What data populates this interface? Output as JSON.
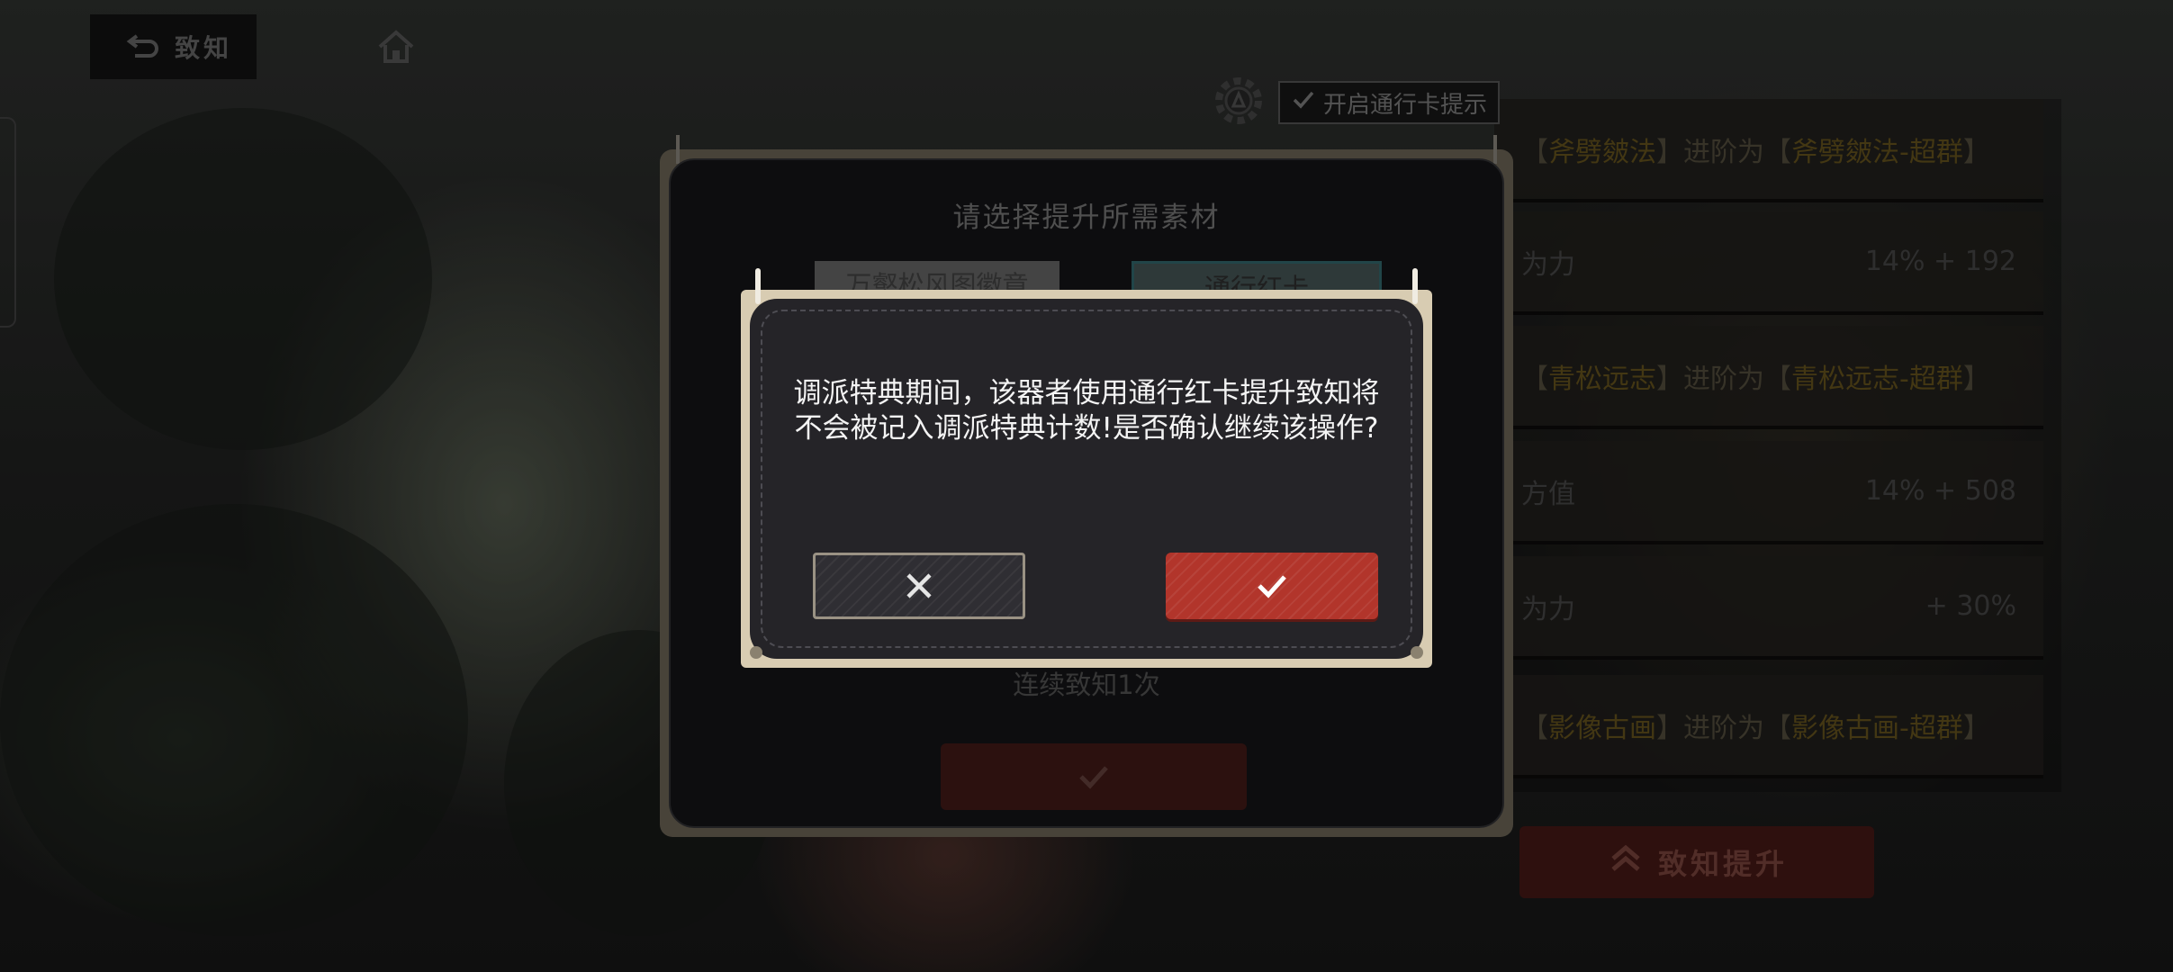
{
  "top_nav": {
    "back_label": "致知"
  },
  "pass_hint": {
    "label": "开启通行卡提示"
  },
  "material_dialog": {
    "title": "请选择提升所需素材",
    "tabs": [
      {
        "label": "万壑松风图徽章"
      },
      {
        "label": "通行红卡"
      }
    ],
    "count_label": "连续致知1次"
  },
  "right_panel": {
    "rows": [
      {
        "prefix": "【",
        "name": "斧劈皴法",
        "mid": "】进阶为【",
        "target": "斧劈皴法-超群",
        "suffix": "】"
      },
      {
        "stat": "为力",
        "value": "14% + 192"
      },
      {
        "prefix": "【",
        "name": "青松远志",
        "mid": "】进阶为【",
        "target": "青松远志-超群",
        "suffix": "】"
      },
      {
        "stat": "方值",
        "value": "14% + 508"
      },
      {
        "stat": "为力",
        "value": "+ 30%"
      },
      {
        "prefix": "【",
        "name": "影像古画",
        "mid": "】进阶为【",
        "target": "影像古画-超群",
        "suffix": "】"
      }
    ],
    "upgrade_button": "致知提升"
  },
  "confirm_modal": {
    "message": "调派特典期间，该器者使用通行红卡提升致知将不会被记入调派特典计数!是否确认继续该操作?"
  },
  "colors": {
    "confirm_red": "#b2352b",
    "modal_frame": "#d8ccb2",
    "modal_bg": "#252428"
  }
}
